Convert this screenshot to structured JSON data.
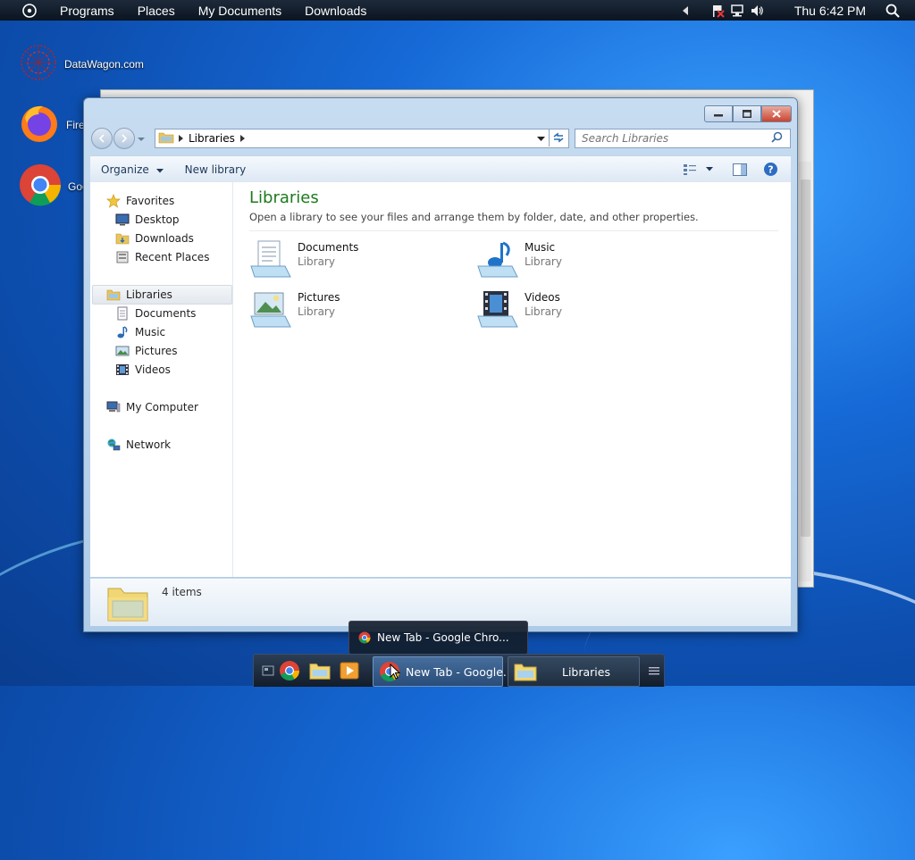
{
  "top_panel": {
    "menu": [
      "Programs",
      "Places",
      "My Documents",
      "Downloads"
    ],
    "clock": "Thu 6:42 PM"
  },
  "desktop": {
    "icons": [
      {
        "label": "DataWagon.com",
        "icon": "datawagon-icon"
      },
      {
        "label": "Fire",
        "icon": "firefox-icon"
      },
      {
        "label": "Goo",
        "icon": "chrome-icon"
      }
    ]
  },
  "explorer": {
    "address_crumb": "Libraries",
    "search_placeholder": "Search Libraries",
    "toolbar": {
      "organize": "Organize",
      "new_library": "New library"
    },
    "nav": {
      "favorites": "Favorites",
      "favorites_items": [
        "Desktop",
        "Downloads",
        "Recent Places"
      ],
      "libraries": "Libraries",
      "libraries_items": [
        "Documents",
        "Music",
        "Pictures",
        "Videos"
      ],
      "computer": "My Computer",
      "network": "Network"
    },
    "main": {
      "title": "Libraries",
      "subtitle": "Open a library to see your files and arrange them by folder, date, and other properties.",
      "items": [
        {
          "name": "Documents",
          "type": "Library"
        },
        {
          "name": "Music",
          "type": "Library"
        },
        {
          "name": "Pictures",
          "type": "Library"
        },
        {
          "name": "Videos",
          "type": "Library"
        }
      ]
    },
    "status": "4 items"
  },
  "taskbar": {
    "preview_tooltip": "New Tab - Google Chro...",
    "tasks": [
      "New Tab - Google...",
      "Libraries"
    ]
  },
  "colors": {
    "title_green": "#1d7a1d",
    "desktop_blue": "#1669d6"
  }
}
